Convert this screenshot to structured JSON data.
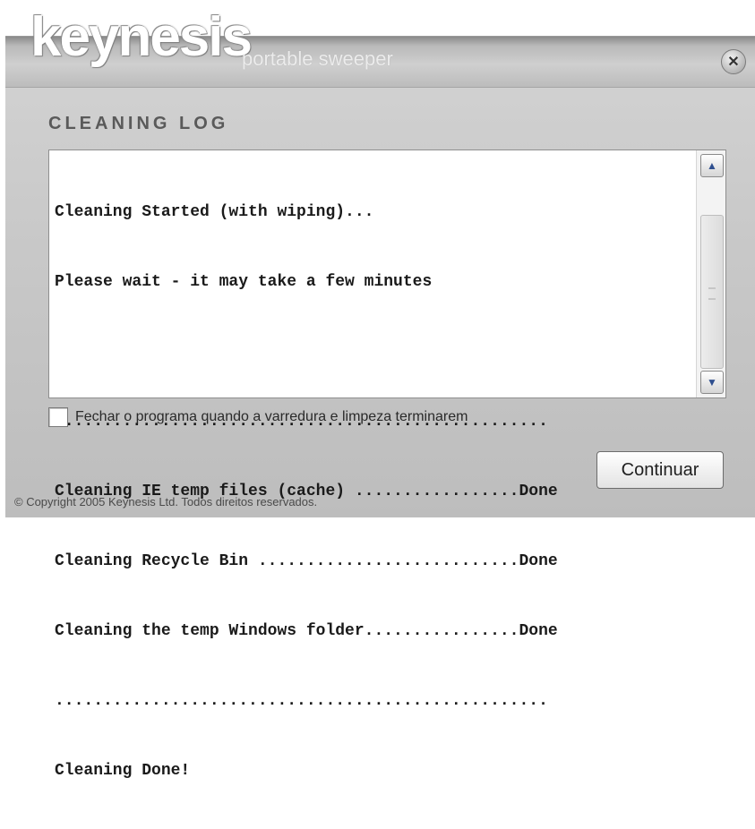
{
  "app": {
    "logo_text": "keynesis",
    "subtitle": "portable sweeper",
    "close_glyph": "✕"
  },
  "log": {
    "title": "CLEANING LOG",
    "lines": [
      "Cleaning Started (with wiping)...",
      "Please wait - it may take a few minutes",
      "...................................................",
      "Cleaning IE temp files (cache) .................Done",
      "Cleaning Recycle Bin ...........................Done",
      "Cleaning the temp Windows folder................Done",
      "...................................................",
      "Cleaning Done!"
    ]
  },
  "scrollbar": {
    "up_glyph": "▲",
    "down_glyph": "▼"
  },
  "options": {
    "close_when_done_label": "Fechar o programa quando a varredura e limpeza terminarem",
    "close_when_done_checked": false
  },
  "buttons": {
    "continue_label": "Continuar"
  },
  "footer": {
    "copyright": "© Copyright 2005 Keynesis Ltd. Todos direitos reservados."
  },
  "colors": {
    "window_bg": "#c9c9c9",
    "title_text": "#5a5a5a"
  }
}
